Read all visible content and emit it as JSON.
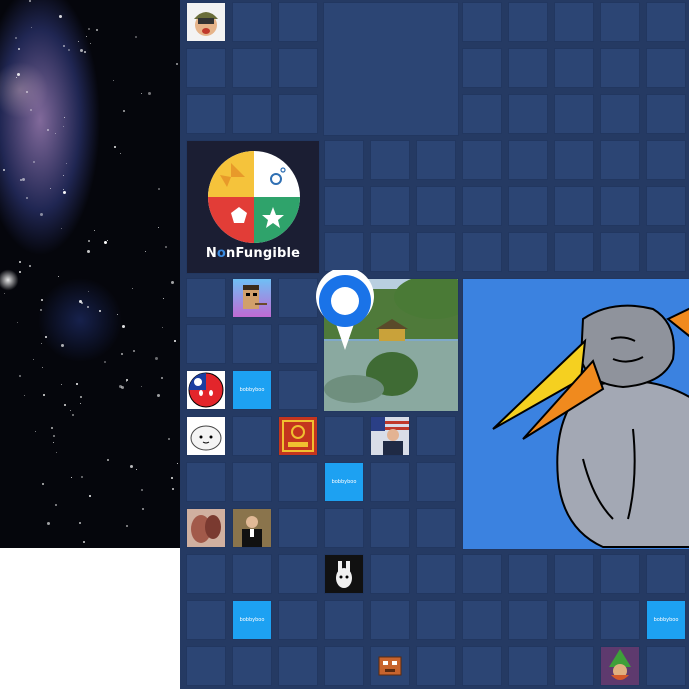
{
  "logo": {
    "brand_prefix": "N",
    "brand_o": "o",
    "brand_suffix": "nFungible"
  },
  "stickers": {
    "label": "bobbyboo"
  },
  "colors": {
    "board_background": "#253a63",
    "cell_background": "#2c4574",
    "cell_border": "#223760",
    "sticker_blue": "#1da1f2",
    "pin_blue": "#1a73e8",
    "bird_background": "#3b82e0"
  },
  "icons": {
    "map_pin": "location-pin-icon"
  }
}
